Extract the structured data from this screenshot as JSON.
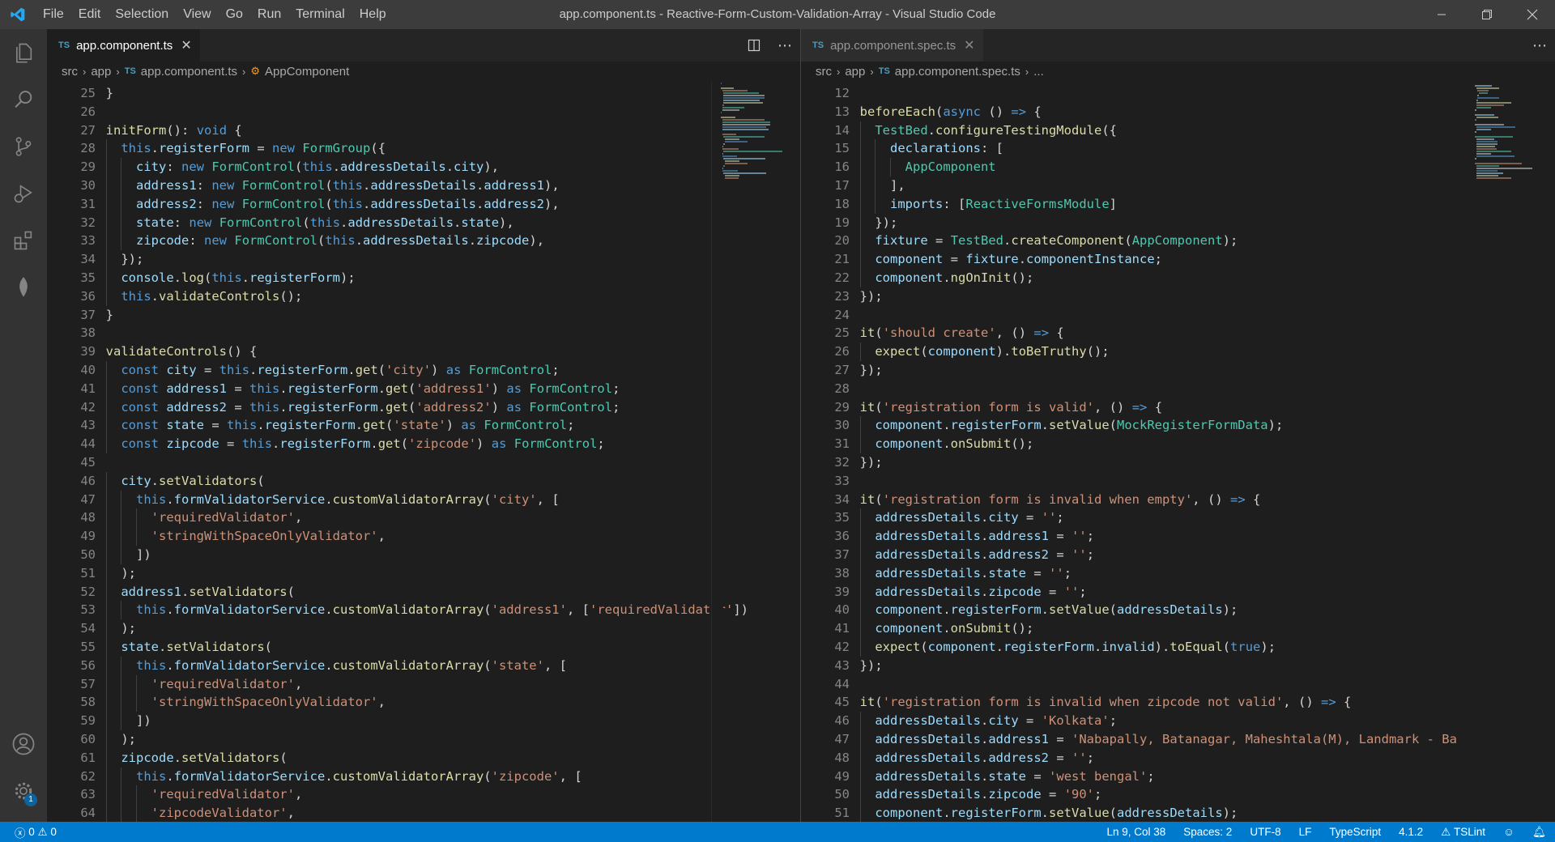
{
  "window": {
    "title": "app.component.ts - Reactive-Form-Custom-Validation-Array - Visual Studio Code",
    "menu": [
      "File",
      "Edit",
      "Selection",
      "View",
      "Go",
      "Run",
      "Terminal",
      "Help"
    ],
    "controls": [
      "minimize-icon",
      "restore-icon",
      "close-icon"
    ]
  },
  "activity_bar": {
    "icons": [
      "files-icon",
      "search-icon",
      "source-control-icon",
      "run-debug-icon",
      "extensions-icon",
      "mongodb-leaf-icon"
    ],
    "bottom_icons": [
      "account-icon",
      "settings-gear-icon"
    ],
    "settings_badge": "1"
  },
  "left_editor": {
    "tab": {
      "badge": "TS",
      "label": "app.component.ts"
    },
    "breadcrumb": [
      "src",
      "app",
      "app.component.ts",
      "AppComponent"
    ],
    "breadcrumb_ts_badge": "TS",
    "lines": [
      [
        "25",
        "  }"
      ],
      [
        "26",
        ""
      ],
      [
        "27",
        "  initForm(): void {"
      ],
      [
        "28",
        "    this.registerForm = new FormGroup({"
      ],
      [
        "29",
        "      city: new FormControl(this.addressDetails.city),"
      ],
      [
        "30",
        "      address1: new FormControl(this.addressDetails.address1),"
      ],
      [
        "31",
        "      address2: new FormControl(this.addressDetails.address2),"
      ],
      [
        "32",
        "      state: new FormControl(this.addressDetails.state),"
      ],
      [
        "33",
        "      zipcode: new FormControl(this.addressDetails.zipcode),"
      ],
      [
        "34",
        "    });"
      ],
      [
        "35",
        "    console.log(this.registerForm);"
      ],
      [
        "36",
        "    this.validateControls();"
      ],
      [
        "37",
        "  }"
      ],
      [
        "38",
        ""
      ],
      [
        "39",
        "  validateControls() {"
      ],
      [
        "40",
        "    const city = this.registerForm.get('city') as FormControl;"
      ],
      [
        "41",
        "    const address1 = this.registerForm.get('address1') as FormControl;"
      ],
      [
        "42",
        "    const address2 = this.registerForm.get('address2') as FormControl;"
      ],
      [
        "43",
        "    const state = this.registerForm.get('state') as FormControl;"
      ],
      [
        "44",
        "    const zipcode = this.registerForm.get('zipcode') as FormControl;"
      ],
      [
        "45",
        ""
      ],
      [
        "46",
        "    city.setValidators("
      ],
      [
        "47",
        "      this.formValidatorService.customValidatorArray('city', ["
      ],
      [
        "48",
        "        'requiredValidator',"
      ],
      [
        "49",
        "        'stringWithSpaceOnlyValidator',"
      ],
      [
        "50",
        "      ])"
      ],
      [
        "51",
        "    );"
      ],
      [
        "52",
        "    address1.setValidators("
      ],
      [
        "53",
        "      this.formValidatorService.customValidatorArray('address1', ['requiredValidator'])"
      ],
      [
        "54",
        "    );"
      ],
      [
        "55",
        "    state.setValidators("
      ],
      [
        "56",
        "      this.formValidatorService.customValidatorArray('state', ["
      ],
      [
        "57",
        "        'requiredValidator',"
      ],
      [
        "58",
        "        'stringWithSpaceOnlyValidator',"
      ],
      [
        "59",
        "      ])"
      ],
      [
        "60",
        "    );"
      ],
      [
        "61",
        "    zipcode.setValidators("
      ],
      [
        "62",
        "      this.formValidatorService.customValidatorArray('zipcode', ["
      ],
      [
        "63",
        "        'requiredValidator',"
      ],
      [
        "64",
        "        'zipcodeValidator',"
      ]
    ]
  },
  "right_editor": {
    "tab": {
      "badge": "TS",
      "label": "app.component.spec.ts"
    },
    "breadcrumb": [
      "src",
      "app",
      "app.component.spec.ts",
      "..."
    ],
    "breadcrumb_ts_badge": "TS",
    "lines": [
      [
        "12",
        ""
      ],
      [
        "13",
        "  beforeEach(async () => {"
      ],
      [
        "14",
        "    TestBed.configureTestingModule({"
      ],
      [
        "15",
        "      declarations: ["
      ],
      [
        "16",
        "        AppComponent"
      ],
      [
        "17",
        "      ],"
      ],
      [
        "18",
        "      imports: [ReactiveFormsModule]"
      ],
      [
        "19",
        "    });"
      ],
      [
        "20",
        "    fixture = TestBed.createComponent(AppComponent);"
      ],
      [
        "21",
        "    component = fixture.componentInstance;"
      ],
      [
        "22",
        "    component.ngOnInit();"
      ],
      [
        "23",
        "  });"
      ],
      [
        "24",
        ""
      ],
      [
        "25",
        "  it('should create', () => {"
      ],
      [
        "26",
        "    expect(component).toBeTruthy();"
      ],
      [
        "27",
        "  });"
      ],
      [
        "28",
        ""
      ],
      [
        "29",
        "  it('registration form is valid', () => {"
      ],
      [
        "30",
        "    component.registerForm.setValue(MockRegisterFormData);"
      ],
      [
        "31",
        "    component.onSubmit();"
      ],
      [
        "32",
        "  });"
      ],
      [
        "33",
        ""
      ],
      [
        "34",
        "  it('registration form is invalid when empty', () => {"
      ],
      [
        "35",
        "    addressDetails.city = '';"
      ],
      [
        "36",
        "    addressDetails.address1 = '';"
      ],
      [
        "37",
        "    addressDetails.address2 = '';"
      ],
      [
        "38",
        "    addressDetails.state = '';"
      ],
      [
        "39",
        "    addressDetails.zipcode = '';"
      ],
      [
        "40",
        "    component.registerForm.setValue(addressDetails);"
      ],
      [
        "41",
        "    component.onSubmit();"
      ],
      [
        "42",
        "    expect(component.registerForm.invalid).toEqual(true);"
      ],
      [
        "43",
        "  });"
      ],
      [
        "44",
        ""
      ],
      [
        "45",
        "  it('registration form is invalid when zipcode not valid', () => {"
      ],
      [
        "46",
        "    addressDetails.city = 'Kolkata';"
      ],
      [
        "47",
        "    addressDetails.address1 = 'Nabapally, Batanagar, Maheshtala(M), Landmark - Ba"
      ],
      [
        "48",
        "    addressDetails.address2 = '';"
      ],
      [
        "49",
        "    addressDetails.state = 'west bengal';"
      ],
      [
        "50",
        "    addressDetails.zipcode = '90';"
      ],
      [
        "51",
        "    component.registerForm.setValue(addressDetails);"
      ]
    ]
  },
  "status_bar": {
    "errors": "0",
    "warnings": "0",
    "position": "Ln 9, Col 38",
    "spaces": "Spaces: 2",
    "encoding": "UTF-8",
    "eol": "LF",
    "language": "TypeScript",
    "version": "4.1.2",
    "lint": "TSLint"
  },
  "colors": {
    "accent": "#007acc",
    "ts_badge": "#519aba"
  }
}
